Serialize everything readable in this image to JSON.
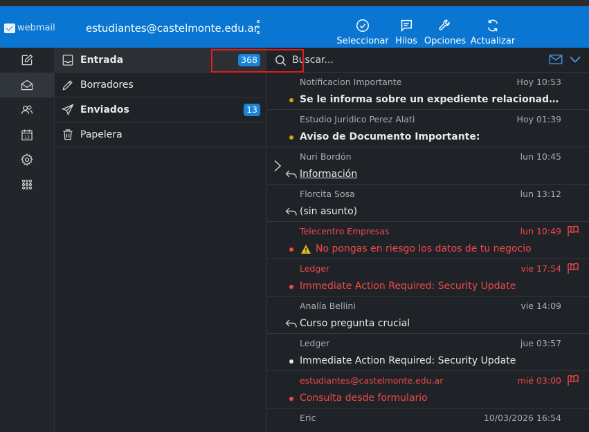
{
  "header": {
    "logo_text": "webmail",
    "account": "estudiantes@castelmonte.edu.ar",
    "actions": [
      {
        "label": "Seleccionar",
        "icon": "check-circle-icon"
      },
      {
        "label": "Hilos",
        "icon": "threads-icon"
      },
      {
        "label": "Opciones",
        "icon": "wrench-icon"
      },
      {
        "label": "Actualizar",
        "icon": "refresh-icon"
      }
    ]
  },
  "rail": [
    {
      "icon": "compose-icon"
    },
    {
      "icon": "mail-icon",
      "active": true
    },
    {
      "icon": "contacts-icon"
    },
    {
      "icon": "calendar-icon",
      "calendar_day": "12"
    },
    {
      "icon": "settings-icon"
    },
    {
      "icon": "apps-grid-icon"
    }
  ],
  "folders": [
    {
      "label": "Entrada",
      "icon": "inbox-icon",
      "count": "368",
      "bold": true,
      "active": true
    },
    {
      "label": "Borradores",
      "icon": "pencil-icon",
      "count": ""
    },
    {
      "label": "Enviados",
      "icon": "send-icon",
      "count": "13",
      "bold": true
    },
    {
      "label": "Papelera",
      "icon": "trash-icon",
      "count": ""
    }
  ],
  "search": {
    "placeholder": "Buscar..."
  },
  "messages": [
    {
      "from": "Notificacion Importante",
      "date": "Hoy 10:53",
      "subject": "Se le informa sobre un expediente relacionado con su n...",
      "bold": true,
      "dot": "#d4a017"
    },
    {
      "from": "Estudio Juridico Perez Alati",
      "date": "Hoy 01:39",
      "subject": "Aviso de Documento Importante:",
      "bold": true,
      "dot": "#d4a017"
    },
    {
      "from": "Nuri Bordón",
      "date": "lun 10:45",
      "subject": "Información",
      "replied": true,
      "expand": true,
      "underline": true
    },
    {
      "from": "Florcita Sosa",
      "date": "lun 13:12",
      "subject": "(sin asunto)",
      "replied": true
    },
    {
      "from": "Telecentro Empresas",
      "date": "lun 10:49",
      "subject": "No pongas en riesgo los datos de tu negocio",
      "red": true,
      "flag": true,
      "dot": "#f04848",
      "warning": true
    },
    {
      "from": "Ledger",
      "date": "vie 17:54",
      "subject": "Immediate Action Required: Security Update",
      "red": true,
      "flag": true,
      "dot": "#f04848"
    },
    {
      "from": "Analía Bellini",
      "date": "vie 14:09",
      "subject": "Curso pregunta crucial",
      "replied": true
    },
    {
      "from": "Ledger",
      "date": "jue 03:57",
      "subject": "Immediate Action Required: Security Update",
      "dot": "#e6e6e6"
    },
    {
      "from": "estudiantes@castelmonte.edu.ar",
      "date": "mié 03:00",
      "subject": "Consulta desde formulario",
      "red": true,
      "flag": true,
      "dot": "#f04848"
    },
    {
      "from": "Eric",
      "date": "10/03/2026 16:54",
      "subject": ""
    }
  ]
}
